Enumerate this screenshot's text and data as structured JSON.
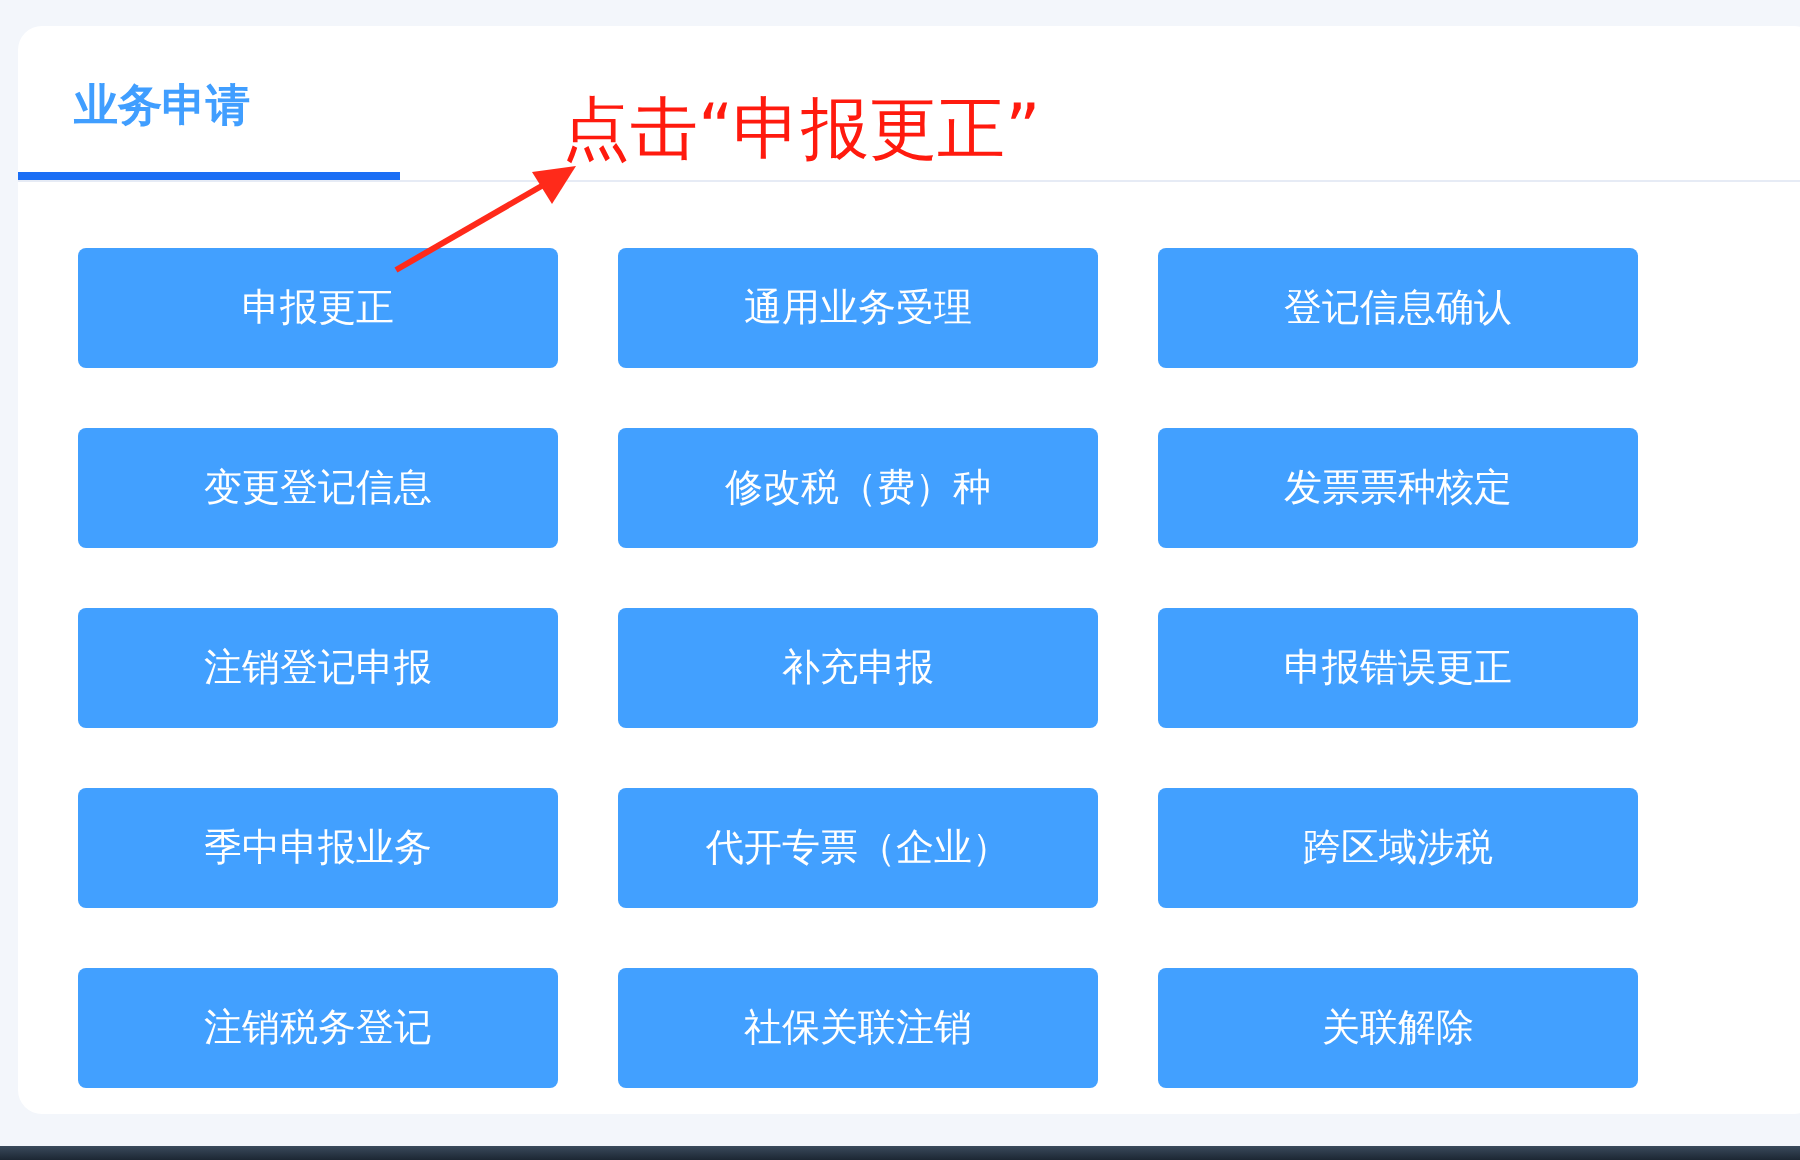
{
  "tabs": [
    {
      "label": "业务申请",
      "selected": true
    }
  ],
  "annotation": {
    "text": "点击“申报更正”"
  },
  "buttons": [
    {
      "label": "申报更正"
    },
    {
      "label": "通用业务受理"
    },
    {
      "label": "登记信息确认"
    },
    {
      "label": "变更登记信息"
    },
    {
      "label": "修改税（费）种"
    },
    {
      "label": "发票票种核定"
    },
    {
      "label": "注销登记申报"
    },
    {
      "label": "补充申报"
    },
    {
      "label": "申报错误更正"
    },
    {
      "label": "季中申报业务"
    },
    {
      "label": "代开专票（企业）"
    },
    {
      "label": "跨区域涉税"
    },
    {
      "label": "注销税务登记"
    },
    {
      "label": "社保关联注销"
    },
    {
      "label": "关联解除"
    }
  ]
}
